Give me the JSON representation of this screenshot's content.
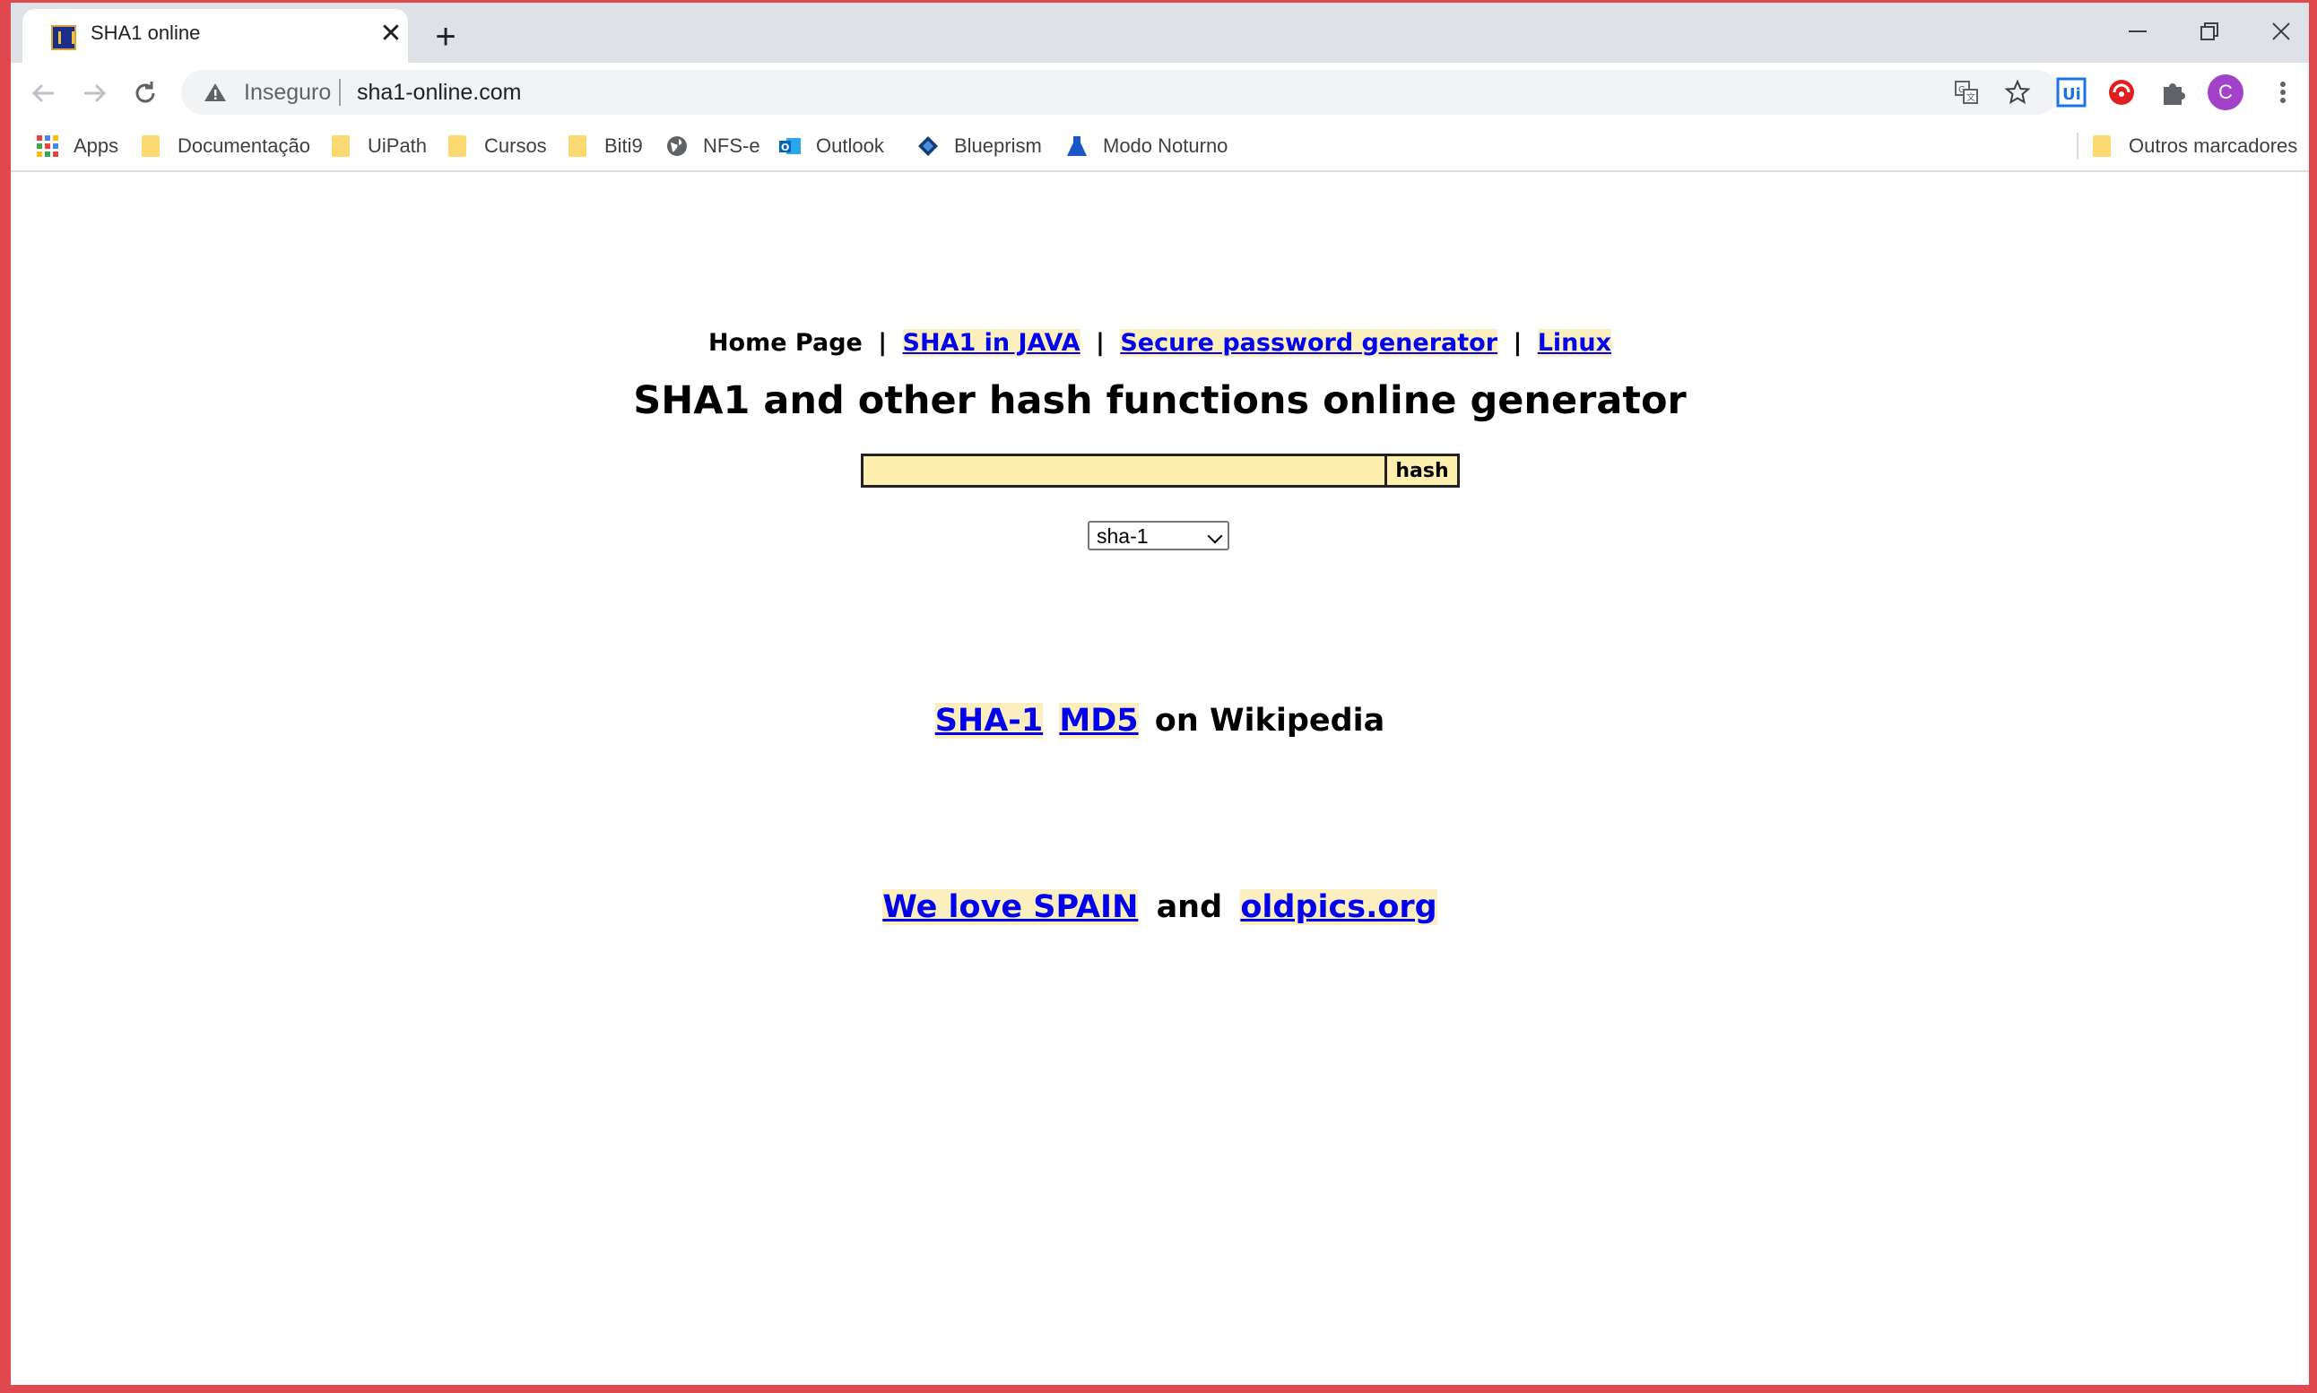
{
  "browser": {
    "tab_title": "SHA1 online",
    "tab_close": "✕",
    "new_tab": "+",
    "window_controls": {
      "minimize": "─",
      "maximize": "❐",
      "close": "✕"
    },
    "security_label": "Inseguro",
    "url": "sha1-online.com",
    "profile_initial": "C",
    "extensions_text": "Ui"
  },
  "bookmarks": [
    {
      "label": "Apps",
      "icon": "apps-grid-icon"
    },
    {
      "label": "Documentação",
      "icon": "folder-icon"
    },
    {
      "label": "UiPath",
      "icon": "folder-icon"
    },
    {
      "label": "Cursos",
      "icon": "folder-icon"
    },
    {
      "label": "Biti9",
      "icon": "folder-icon"
    },
    {
      "label": "NFS-e",
      "icon": "globe-icon"
    },
    {
      "label": "Outlook",
      "icon": "outlook-icon"
    },
    {
      "label": "Blueprism",
      "icon": "blueprism-icon"
    },
    {
      "label": "Modo Noturno",
      "icon": "flask-icon"
    }
  ],
  "other_bookmarks": "Outros marcadores",
  "page": {
    "nav": {
      "home": "Home Page",
      "separator": "|",
      "links": [
        "SHA1 in JAVA",
        "Secure password generator",
        "Linux"
      ]
    },
    "title": "SHA1 and other hash functions online generator",
    "input_value": "",
    "hash_button": "hash",
    "algorithm_selected": "sha-1",
    "wiki": {
      "link1": "SHA-1",
      "link2": "MD5",
      "suffix": "on Wikipedia"
    },
    "love": {
      "link1": "We love SPAIN",
      "middle": "and",
      "link2": "oldpics.org"
    }
  },
  "colors": {
    "link": "#0000ee",
    "link_highlight": "#fcefbf",
    "input_bg": "#ffefaf",
    "frame_border": "#e0484e",
    "folder": "#fbd872"
  }
}
